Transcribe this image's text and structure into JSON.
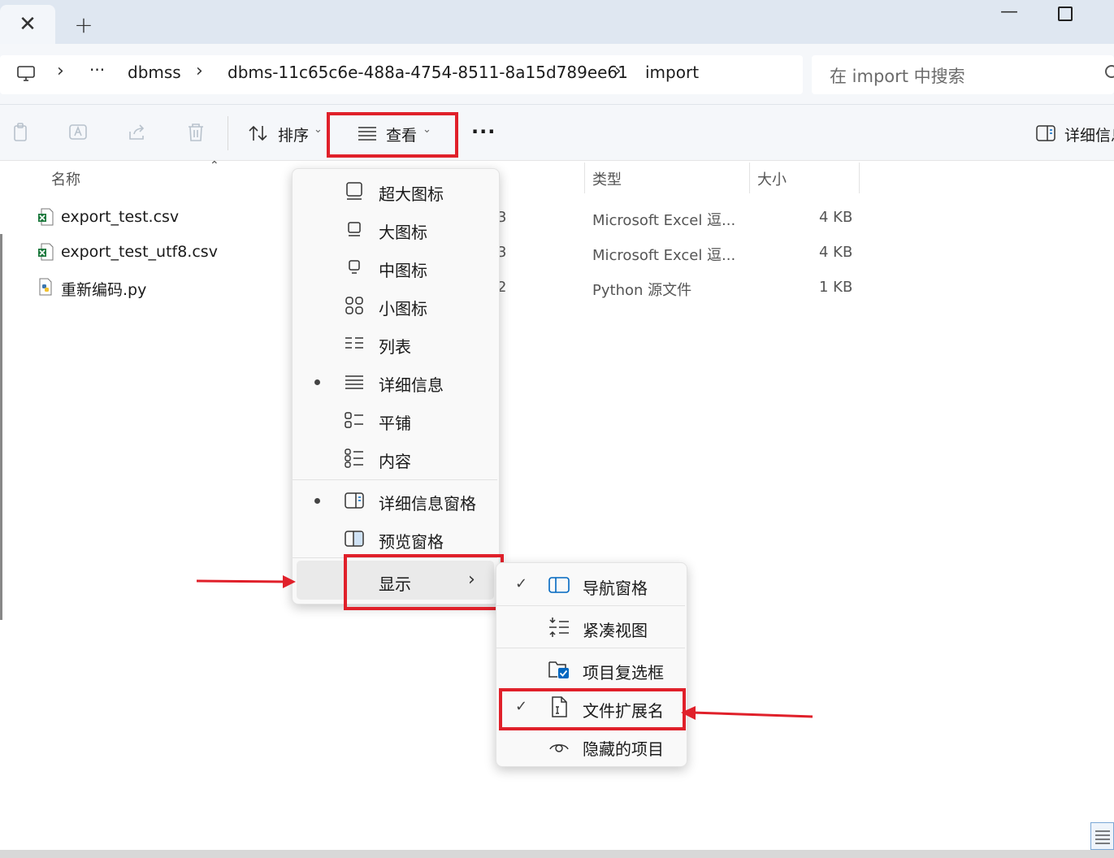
{
  "window": {
    "tab_close_glyph": "✕",
    "tab_new_glyph": "+",
    "minimize_glyph": "—"
  },
  "address": {
    "crumbs": [
      "dbmss",
      "dbms-11c65c6e-488a-4754-8511-8a15d789ee61",
      "import"
    ],
    "ellipsis": "···",
    "separator": "›"
  },
  "search": {
    "placeholder": "在 import 中搜索"
  },
  "toolbar": {
    "sort_label": "排序",
    "view_label": "查看",
    "more_label": "···",
    "details_label": "详细信息"
  },
  "columns": {
    "name": "名称",
    "type": "类型",
    "size": "大小"
  },
  "files": [
    {
      "name": "export_test.csv",
      "date_fragment": "3",
      "type": "Microsoft Excel 逗...",
      "size": "4 KB",
      "icon": "excel-icon"
    },
    {
      "name": "export_test_utf8.csv",
      "date_fragment": "3",
      "type": "Microsoft Excel 逗...",
      "size": "4 KB",
      "icon": "excel-icon"
    },
    {
      "name": "重新编码.py",
      "date_fragment": "2",
      "type": "Python 源文件",
      "size": "1 KB",
      "icon": "python-icon"
    }
  ],
  "view_menu": {
    "items": [
      {
        "label": "超大图标",
        "icon": "extra-large-icons-icon",
        "selected": false
      },
      {
        "label": "大图标",
        "icon": "large-icons-icon",
        "selected": false
      },
      {
        "label": "中图标",
        "icon": "medium-icons-icon",
        "selected": false
      },
      {
        "label": "小图标",
        "icon": "small-icons-icon",
        "selected": false
      },
      {
        "label": "列表",
        "icon": "list-icon",
        "selected": false
      },
      {
        "label": "详细信息",
        "icon": "details-icon",
        "selected": true
      },
      {
        "label": "平铺",
        "icon": "tiles-icon",
        "selected": false
      },
      {
        "label": "内容",
        "icon": "content-icon",
        "selected": false
      }
    ],
    "panes": [
      {
        "label": "详细信息窗格",
        "icon": "details-pane-icon",
        "selected": true
      },
      {
        "label": "预览窗格",
        "icon": "preview-pane-icon",
        "selected": false
      }
    ],
    "show_label": "显示",
    "show_chevron": "›"
  },
  "show_submenu": {
    "items": [
      {
        "label": "导航窗格",
        "icon": "navigation-pane-icon",
        "checked": true
      },
      {
        "label": "紧凑视图",
        "icon": "compact-view-icon",
        "checked": false
      },
      {
        "label": "项目复选框",
        "icon": "item-checkbox-icon",
        "checked": false
      },
      {
        "label": "文件扩展名",
        "icon": "file-extension-icon",
        "checked": true
      },
      {
        "label": "隐藏的项目",
        "icon": "hidden-items-icon",
        "checked": false
      }
    ],
    "check_glyph": "✓"
  },
  "colors": {
    "highlight_box": "#e0202a",
    "excel_green": "#1d7a3e",
    "accent": "#0067c0"
  }
}
